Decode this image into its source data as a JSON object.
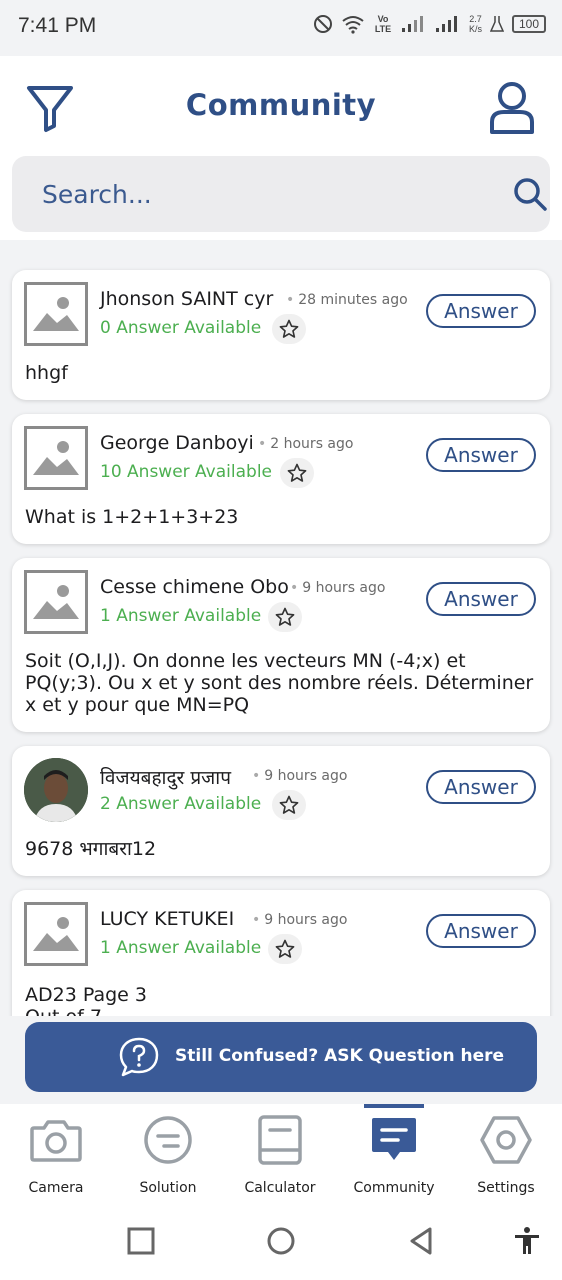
{
  "status_bar": {
    "time": "7:41 PM",
    "network_label": "Vo LTE",
    "speed_value": "2.7",
    "speed_unit": "K/s",
    "battery": "100"
  },
  "header": {
    "title": "Community",
    "search_placeholder": "Search..."
  },
  "colors": {
    "brand": "#2f4f86",
    "accent_button": "#3a5a97",
    "answer_green": "#4caf50"
  },
  "posts": [
    {
      "author": "Jhonson SAINT cyr",
      "time": "28 minutes ago",
      "answers": "0 Answer Available",
      "answer_label": "Answer",
      "body": "hhgf",
      "avatar": "placeholder"
    },
    {
      "author": "George Danboyi",
      "time": "2 hours ago",
      "answers": "10 Answer Available",
      "answer_label": "Answer",
      "body": "What is 1+2+1+3+23",
      "avatar": "placeholder"
    },
    {
      "author": "Cesse chimene Obo",
      "time": "9 hours ago",
      "answers": "1 Answer Available",
      "answer_label": "Answer",
      "body": "Soit (O,I,J). On donne les vecteurs MN (-4;x) et PQ(y;3). Ou x et y sont des nombre réels. Déterminer x et y pour que MN=PQ",
      "avatar": "placeholder"
    },
    {
      "author": "विजयबहादुर प्रजाप",
      "time": "9 hours ago",
      "answers": "2 Answer Available",
      "answer_label": "Answer",
      "body": "9678 भगाबरा12",
      "avatar": "photo"
    },
    {
      "author": "LUCY KETUKEI",
      "time": "9 hours ago",
      "answers": "1 Answer Available",
      "answer_label": "Answer",
      "body": "AD23 Page 3\nOut of 7",
      "avatar": "placeholder"
    }
  ],
  "ask_button": {
    "label": "Still Confused? ASK Question here",
    "icon": "question-bubble-icon"
  },
  "bottom_nav": {
    "active": "Community",
    "items": [
      {
        "label": "Camera",
        "icon": "camera-icon"
      },
      {
        "label": "Solution",
        "icon": "solution-icon"
      },
      {
        "label": "Calculator",
        "icon": "calculator-icon"
      },
      {
        "label": "Community",
        "icon": "community-chat-icon"
      },
      {
        "label": "Settings",
        "icon": "settings-hexagon-icon"
      }
    ]
  },
  "system_nav": {
    "icons": [
      "recents-square-icon",
      "home-circle-icon",
      "back-triangle-icon",
      "accessibility-icon"
    ]
  }
}
